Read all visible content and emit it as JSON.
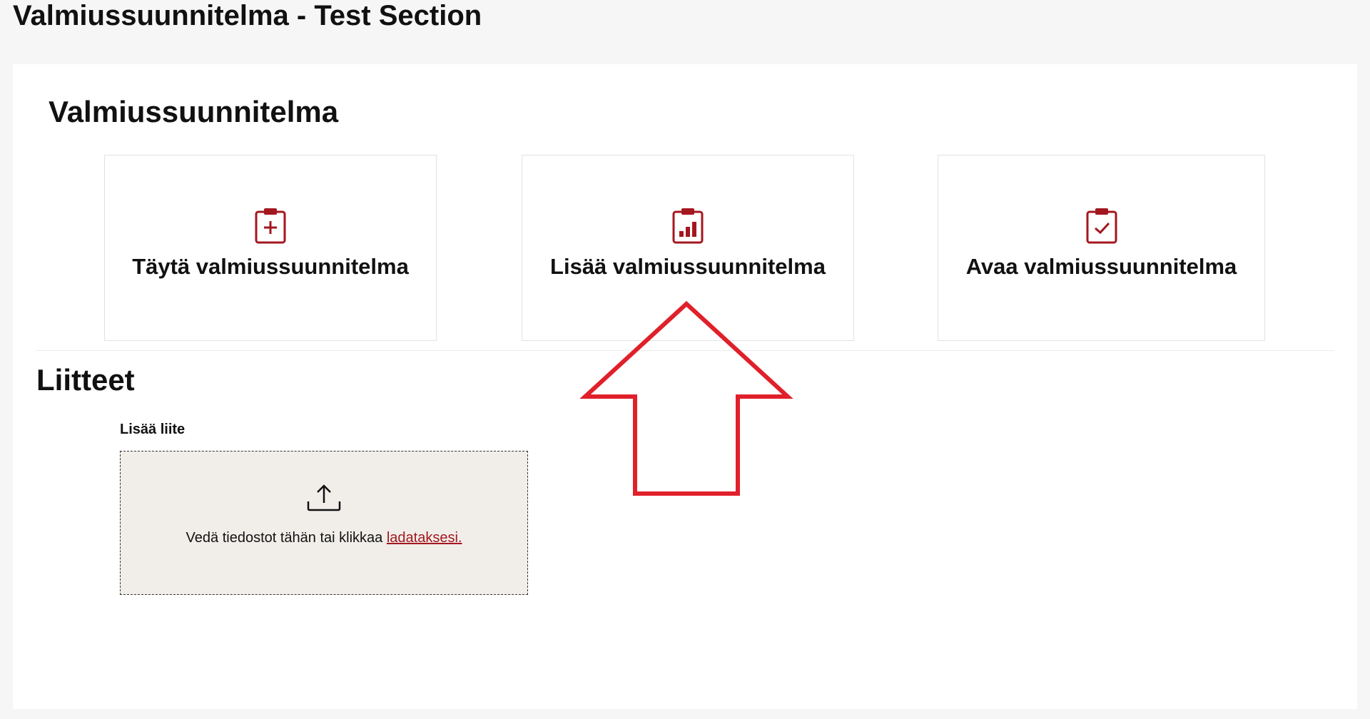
{
  "header": {
    "title": "Valmiussuunnitelma - Test Section"
  },
  "plan_section": {
    "title": "Valmiussuunnitelma",
    "cards": [
      {
        "label": "Täytä valmiussuunnitelma",
        "icon": "clipboard-plus-icon"
      },
      {
        "label": "Lisää valmiussuunnitelma",
        "icon": "clipboard-chart-icon"
      },
      {
        "label": "Avaa valmiussuunnitelma",
        "icon": "clipboard-check-icon"
      }
    ]
  },
  "attachments": {
    "title": "Liitteet",
    "upload_label": "Lisää liite",
    "drop_text": "Vedä tiedostot tähän tai klikkaa",
    "drop_link": "ladataksesi.",
    "upload_icon": "upload-icon"
  },
  "annotation": {
    "arrow_icon": "red-arrow-up-icon",
    "arrow_color": "#e0202a"
  },
  "colors": {
    "accent": "#a3171f",
    "background": "#f6f6f6",
    "panel": "#ffffff",
    "dropzone": "#f1eeea"
  }
}
